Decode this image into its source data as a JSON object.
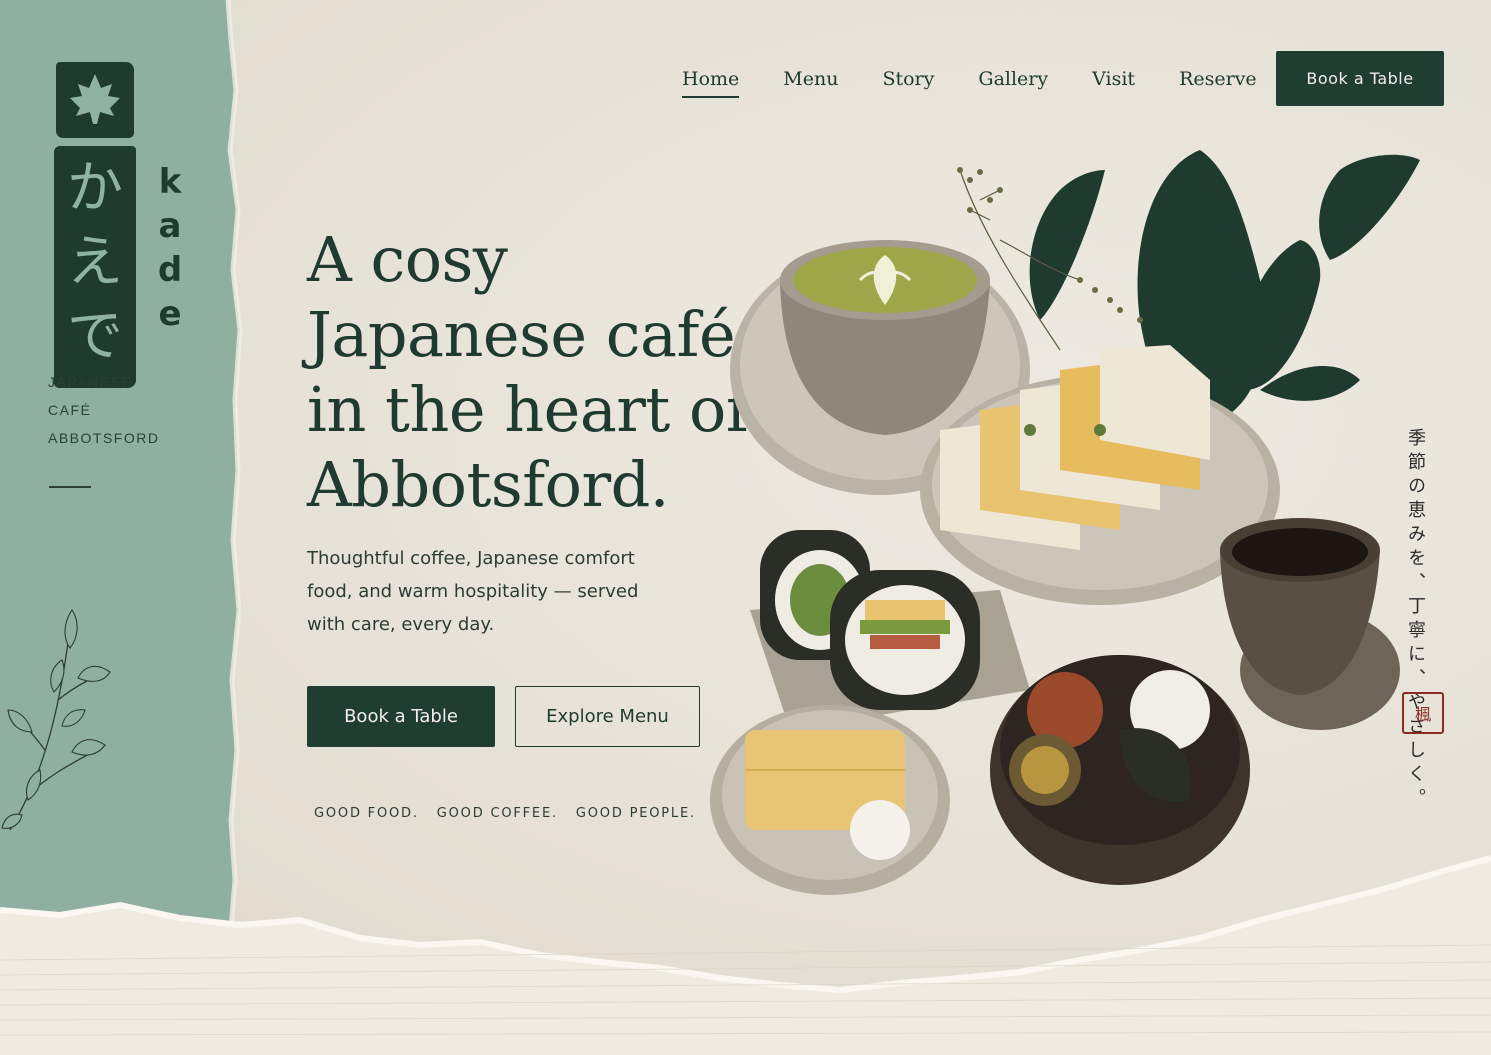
{
  "brand": {
    "kana": [
      "か",
      "え",
      "で"
    ],
    "latin": [
      "k",
      "a",
      "d",
      "e"
    ],
    "tagline": [
      "JAPANESE",
      "CAFÉ",
      "ABBOTSFORD"
    ]
  },
  "nav": {
    "items": [
      {
        "label": "Home",
        "active": true
      },
      {
        "label": "Menu"
      },
      {
        "label": "Story"
      },
      {
        "label": "Gallery"
      },
      {
        "label": "Visit"
      },
      {
        "label": "Reserve"
      }
    ],
    "cta_label": "Book a Table"
  },
  "hero": {
    "title_lines": [
      "A cosy",
      "Japanese café",
      "in the heart of",
      "Abbotsford."
    ],
    "subtitle": "Thoughtful coffee, Japanese comfort food, and warm hospitality — served with care, every day.",
    "primary_button": "Book a Table",
    "secondary_button": "Explore Menu",
    "motto": [
      "GOOD FOOD.",
      "GOOD COFFEE.",
      "GOOD PEOPLE."
    ]
  },
  "vertical_text": "季節の恵みを、丁寧に、やさしく。",
  "seal_text": "楓",
  "colors": {
    "primary": "#1f3d31",
    "sage": "#8fafa0",
    "paper": "#e8e3d9",
    "seal_red": "#8a2c25"
  }
}
